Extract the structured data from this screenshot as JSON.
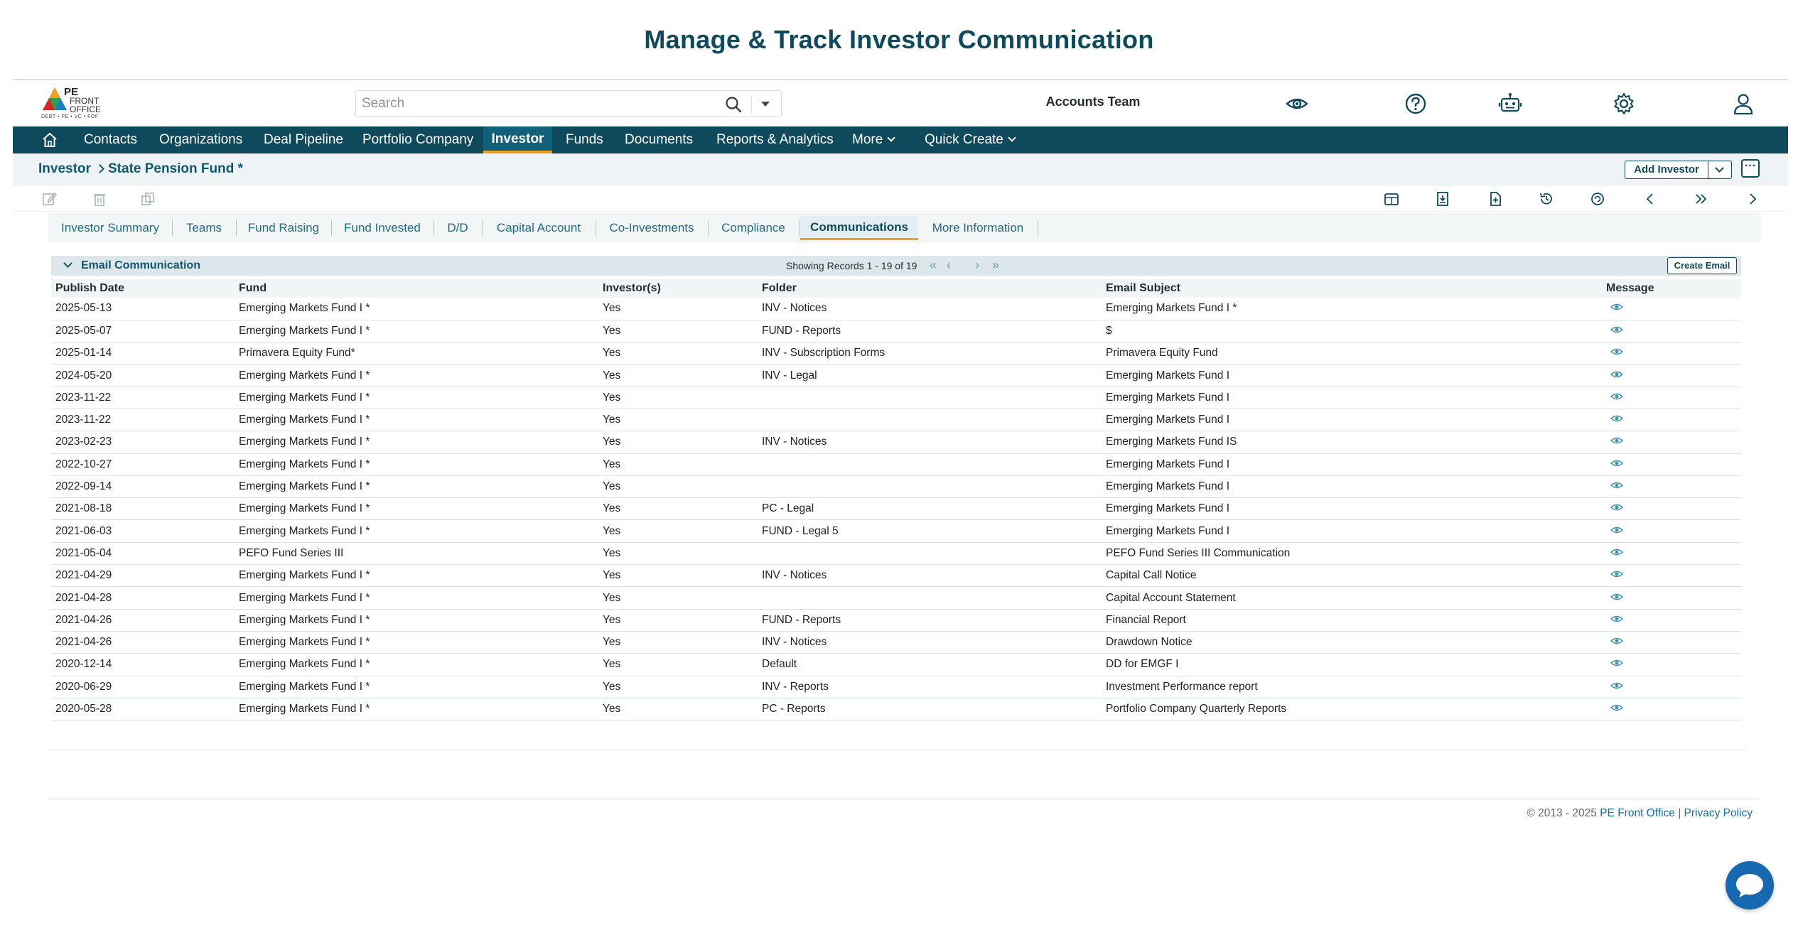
{
  "page": {
    "heading": "Manage & Track Investor Communication"
  },
  "topbar": {
    "logo_brand": "PE",
    "logo_sub": "FRONT OFFICE",
    "logo_tagline": "DEBT • PE • VC • FOF",
    "search_placeholder": "Search",
    "team": "Accounts Team",
    "icons": [
      "eye-icon",
      "help-icon",
      "robot-icon",
      "gear-icon",
      "user-icon"
    ]
  },
  "nav": {
    "items": [
      {
        "label": "Contacts"
      },
      {
        "label": "Organizations"
      },
      {
        "label": "Deal Pipeline"
      },
      {
        "label": "Portfolio Company"
      },
      {
        "label": "Investor",
        "active": true
      },
      {
        "label": "Funds"
      },
      {
        "label": "Documents"
      },
      {
        "label": "Reports & Analytics"
      },
      {
        "label": "More",
        "dropdown": true
      },
      {
        "label": "Quick Create",
        "dropdown": true
      }
    ]
  },
  "breadcrumb": {
    "root": "Investor",
    "current": "State Pension Fund *"
  },
  "actions": {
    "add_label": "Add Investor",
    "more_label": "···"
  },
  "toolbar_icons": [
    "edit-icon",
    "delete-icon",
    "duplicate-icon",
    "calendar-icon",
    "archive-icon",
    "document-icon",
    "history-icon",
    "refresh-icon",
    "prev-icon",
    "last-icon",
    "next-icon"
  ],
  "tabs": [
    {
      "label": "Investor Summary"
    },
    {
      "label": "Teams"
    },
    {
      "label": "Fund Raising"
    },
    {
      "label": "Fund Invested"
    },
    {
      "label": "D/D"
    },
    {
      "label": "Capital Account"
    },
    {
      "label": "Co-Investments"
    },
    {
      "label": "Compliance"
    },
    {
      "label": "Communications",
      "active": true
    },
    {
      "label": "More Information"
    }
  ],
  "panel": {
    "title": "Email Communication",
    "records": "Showing Records 1 - 19 of 19",
    "create_label": "Create Email",
    "columns": [
      "Publish Date",
      "Fund",
      "Investor(s)",
      "Folder",
      "Email Subject",
      "Message"
    ],
    "rows": [
      [
        "2025-05-13",
        "Emerging Markets Fund I *",
        "Yes",
        "INV - Notices",
        "Emerging Markets Fund I *"
      ],
      [
        "2025-05-07",
        "Emerging Markets Fund I *",
        "Yes",
        "FUND - Reports",
        "$"
      ],
      [
        "2025-01-14",
        "Primavera Equity Fund*",
        "Yes",
        "INV - Subscription Forms",
        "Primavera Equity Fund"
      ],
      [
        "2024-05-20",
        "Emerging Markets Fund I *",
        "Yes",
        "INV - Legal",
        "Emerging Markets Fund I"
      ],
      [
        "2023-11-22",
        "Emerging Markets Fund I *",
        "Yes",
        "",
        "Emerging Markets Fund I"
      ],
      [
        "2023-11-22",
        "Emerging Markets Fund I *",
        "Yes",
        "",
        "Emerging Markets Fund I"
      ],
      [
        "2023-02-23",
        "Emerging Markets Fund I *",
        "Yes",
        "INV - Notices",
        "Emerging Markets Fund IS"
      ],
      [
        "2022-10-27",
        "Emerging Markets Fund I *",
        "Yes",
        "",
        "Emerging Markets Fund I"
      ],
      [
        "2022-09-14",
        "Emerging Markets Fund I *",
        "Yes",
        "",
        "Emerging Markets Fund I"
      ],
      [
        "2021-08-18",
        "Emerging Markets Fund I *",
        "Yes",
        "PC - Legal",
        "Emerging Markets Fund I"
      ],
      [
        "2021-06-03",
        "Emerging Markets Fund I *",
        "Yes",
        "FUND - Legal 5",
        "Emerging Markets Fund I"
      ],
      [
        "2021-05-04",
        "PEFO Fund Series III",
        "Yes",
        "",
        "PEFO Fund Series III Communication"
      ],
      [
        "2021-04-29",
        "Emerging Markets Fund I *",
        "Yes",
        "INV - Notices",
        "Capital Call Notice"
      ],
      [
        "2021-04-28",
        "Emerging Markets Fund I *",
        "Yes",
        "",
        "Capital Account Statement"
      ],
      [
        "2021-04-26",
        "Emerging Markets Fund I *",
        "Yes",
        "FUND - Reports",
        "Financial Report"
      ],
      [
        "2021-04-26",
        "Emerging Markets Fund I *",
        "Yes",
        "INV - Notices",
        "Drawdown Notice"
      ],
      [
        "2020-12-14",
        "Emerging Markets Fund I *",
        "Yes",
        "Default",
        "DD for EMGF I"
      ],
      [
        "2020-06-29",
        "Emerging Markets Fund I *",
        "Yes",
        "INV - Reports",
        "Investment Performance report"
      ],
      [
        "2020-05-28",
        "Emerging Markets Fund I *",
        "Yes",
        "PC - Reports",
        "Portfolio Company Quarterly Reports"
      ]
    ]
  },
  "footer": {
    "copyright": "© 2013 - 2025 ",
    "company": "PE Front Office",
    "sep": " | ",
    "privacy": "Privacy Policy"
  },
  "colors": {
    "primary": "#0e4a5c",
    "accent": "#f0a020",
    "link": "#1d6c84",
    "chat": "#1668b0"
  }
}
